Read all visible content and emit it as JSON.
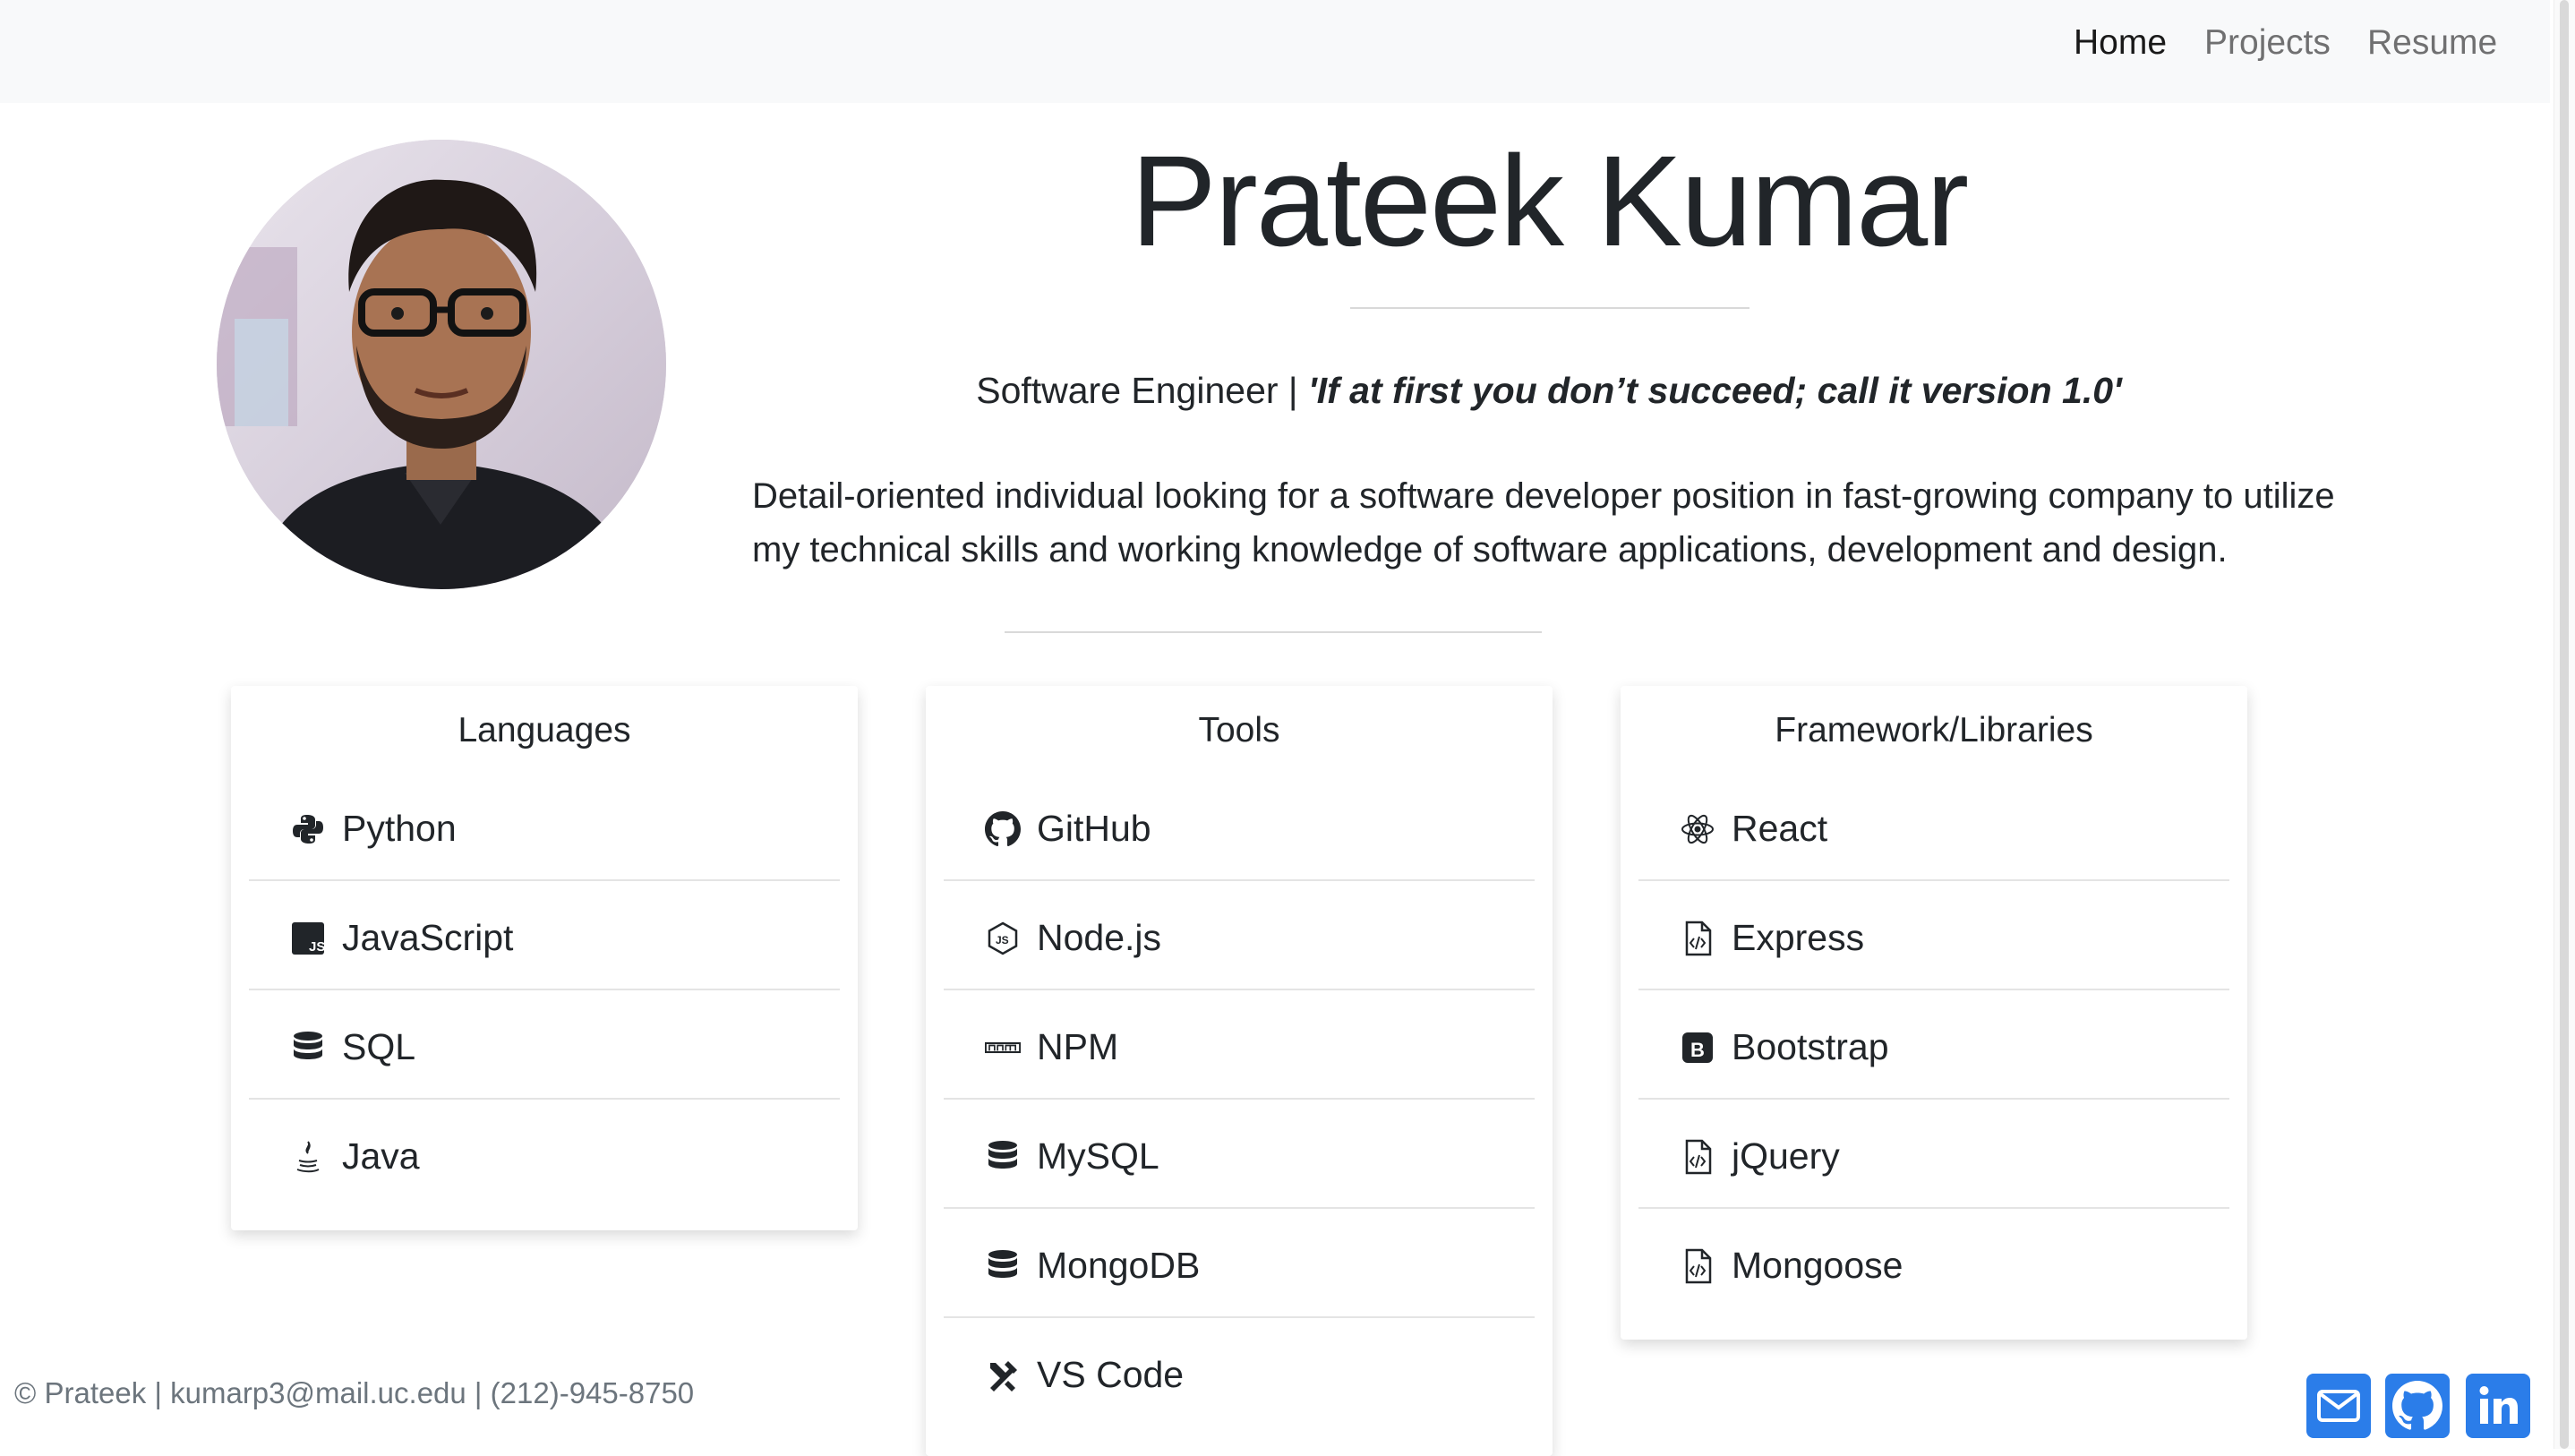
{
  "nav": {
    "home": "Home",
    "projects": "Projects",
    "resume": "Resume"
  },
  "profile": {
    "name": "Prateek Kumar",
    "role": "Software Engineer | ",
    "quote": "'If at first you don’t succeed; call it version 1.0'",
    "summary": "Detail-oriented individual looking for a software developer position in fast-growing company to utilize my technical skills and working knowledge of software applications, development and design."
  },
  "cards": {
    "languages": {
      "title": "Languages",
      "items": [
        {
          "label": "Python",
          "icon": "python-icon"
        },
        {
          "label": "JavaScript",
          "icon": "javascript-icon"
        },
        {
          "label": "SQL",
          "icon": "database-icon"
        },
        {
          "label": "Java",
          "icon": "java-icon"
        }
      ]
    },
    "tools": {
      "title": "Tools",
      "items": [
        {
          "label": "GitHub",
          "icon": "github-icon"
        },
        {
          "label": "Node.js",
          "icon": "nodejs-icon"
        },
        {
          "label": "NPM",
          "icon": "npm-icon"
        },
        {
          "label": "MySQL",
          "icon": "database-icon"
        },
        {
          "label": "MongoDB",
          "icon": "database-icon"
        },
        {
          "label": "VS Code",
          "icon": "tools-icon"
        }
      ]
    },
    "frameworks": {
      "title": "Framework/Libraries",
      "items": [
        {
          "label": "React",
          "icon": "react-icon"
        },
        {
          "label": "Express",
          "icon": "file-code-icon"
        },
        {
          "label": "Bootstrap",
          "icon": "bootstrap-icon"
        },
        {
          "label": "jQuery",
          "icon": "file-code-icon"
        },
        {
          "label": "Mongoose",
          "icon": "file-code-icon"
        }
      ]
    }
  },
  "footer": {
    "text": "© Prateek | kumarp3@mail.uc.edu | (212)-945-8750",
    "social": [
      "envelope-icon",
      "github-icon",
      "linkedin-icon"
    ]
  },
  "colors": {
    "accent": "#2b7de9",
    "navbar_bg": "#f8f9fa",
    "text": "#212529",
    "muted": "#6c757d"
  }
}
